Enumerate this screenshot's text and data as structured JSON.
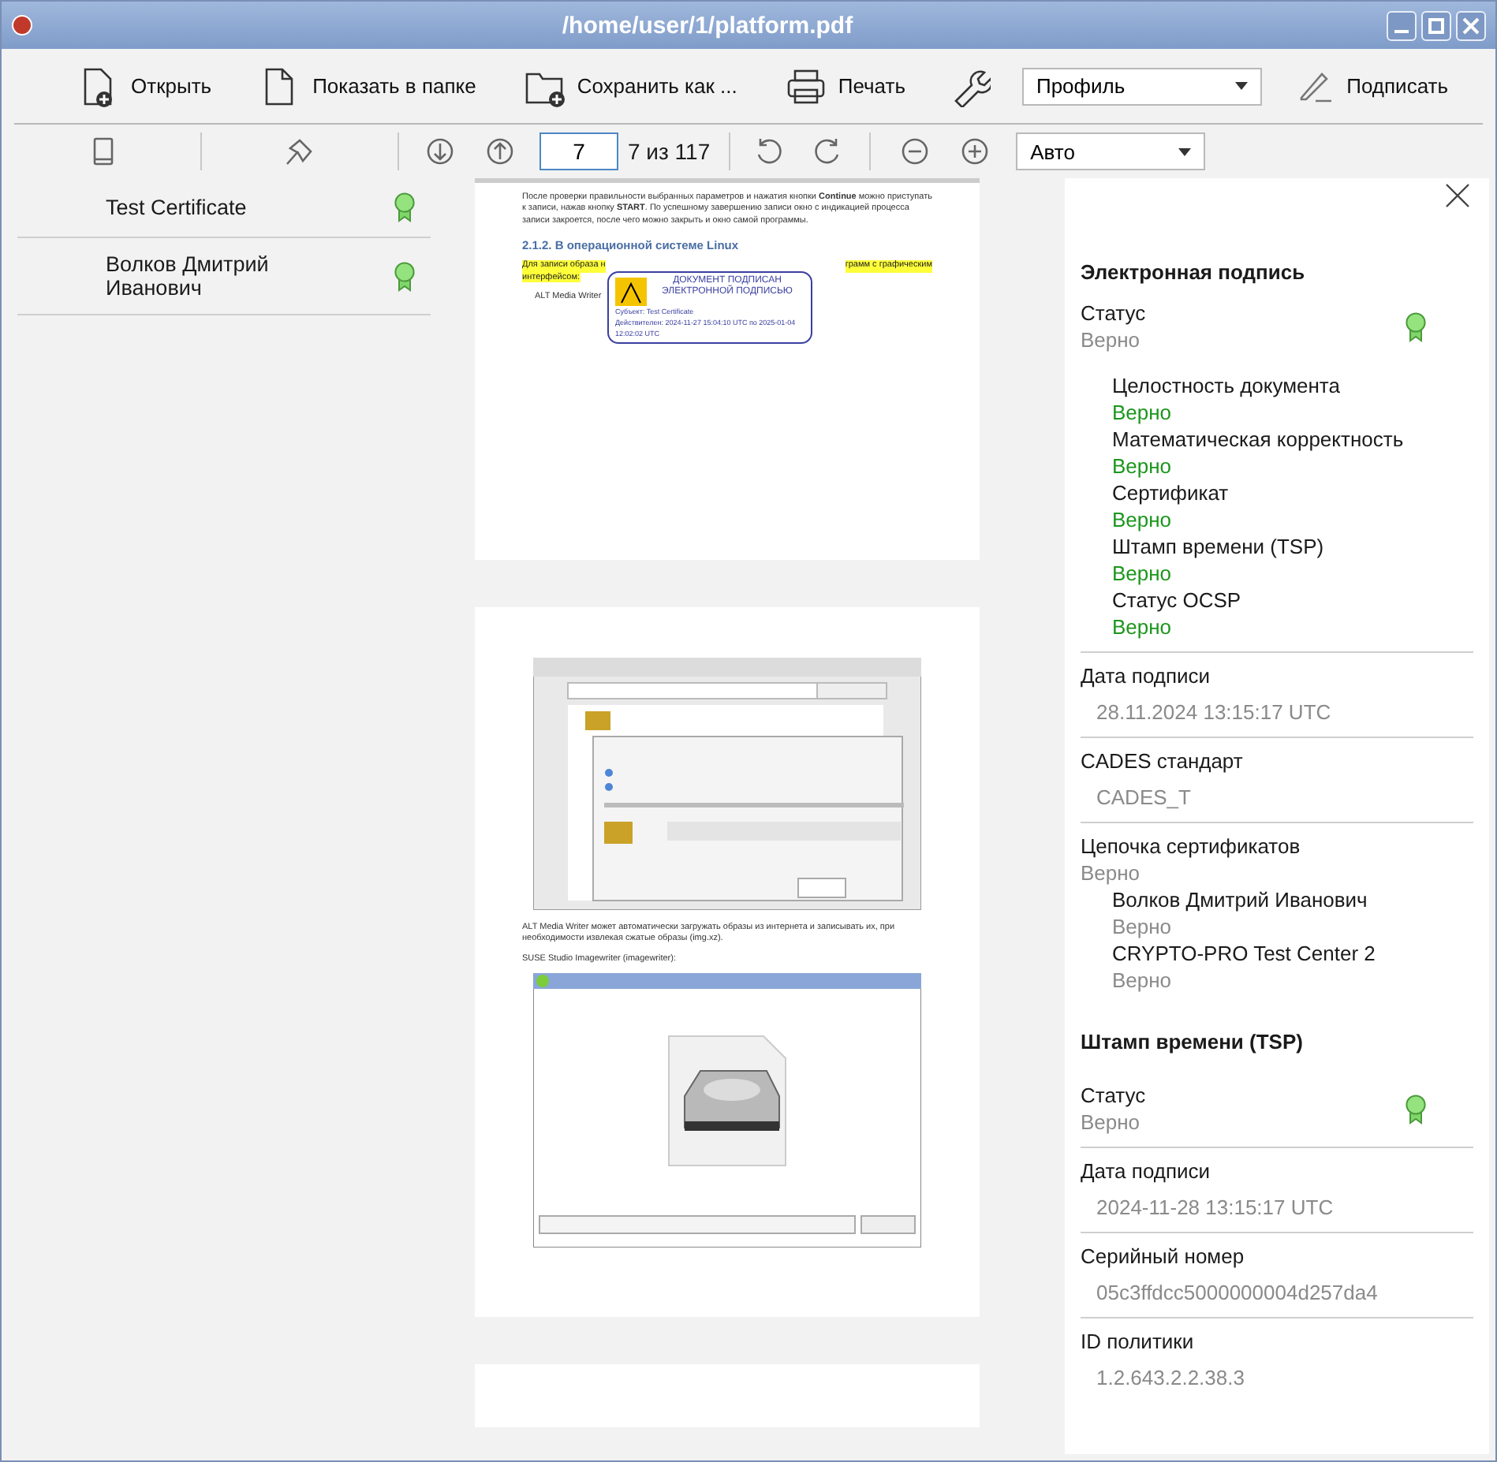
{
  "window": {
    "title": "/home/user/1/platform.pdf"
  },
  "toolbar": {
    "buttons": [
      {
        "label": "Открыть"
      },
      {
        "label": "Показать в папке"
      },
      {
        "label": "Сохранить как ..."
      },
      {
        "label": "Печать"
      }
    ],
    "profile": "Профиль",
    "sign": "Подписать"
  },
  "navbar": {
    "page": "7",
    "page_count": "7 из 117",
    "zoom": "Авто"
  },
  "signatures": [
    {
      "name": "Test Certificate",
      "selected": false
    },
    {
      "name": "Волков Дмитрий Иванович",
      "selected": false
    }
  ],
  "document": {
    "page1": {
      "paragraph": "После проверки правильности выбранных параметров и нажатия кнопки **Continue** можно приступать к записи, нажав кнопку **START**. По успешному завершению записи окно с индикацией процесса записи закроется, после чего можно закрыть и окно самой программы.",
      "heading": "2.1.2. В операционной системе Linux",
      "highlight_left": "Для записи образа н",
      "highlight_right": "грамм с графическим",
      "highlight_line2": "интерфейсом:",
      "bullet": "ALT Media Writer",
      "stamp": {
        "title": "ДОКУМЕНТ ПОДПИСАН ЭЛЕКТРОННОЙ ПОДПИСЬЮ",
        "lines": [
          "Субъект: Test Certificate",
          "Действителен: 2024-11-27 15:04:10 UTC по 2025-01-04 12:02:02 UTC"
        ]
      }
    },
    "page2": {
      "text": "ALT Media Writer может автоматически загружать образы из интернета и записывать их, при необходимости извлекая сжатые образы (img.xz).",
      "bullet": "SUSE Studio Imagewriter (imagewriter):"
    }
  },
  "details": {
    "signature_title": "Электронная подпись",
    "status": {
      "label": "Статус",
      "value": "Верно"
    },
    "checks": [
      {
        "label": "Целостность документа",
        "value": "Верно"
      },
      {
        "label": "Математическая корректность",
        "value": "Верно"
      },
      {
        "label": "Сертификат",
        "value": "Верно"
      },
      {
        "label": "Штамп времени (TSP)",
        "value": "Верно"
      },
      {
        "label": "Статус OCSP",
        "value": "Верно"
      }
    ],
    "date": {
      "label": "Дата подписи",
      "value": "28.11.2024 13:15:17 UTC"
    },
    "cades": {
      "label": "CADES стандарт",
      "value": "CADES_T"
    },
    "chain": {
      "label": "Цепочка сертификатов",
      "value": "Верно",
      "children": [
        {
          "label": "Волков Дмитрий Иванович",
          "value": "Верно"
        },
        {
          "label": "CRYPTO-PRO Test Center 2",
          "value": "Верно"
        }
      ]
    },
    "tsp_title": "Штамп времени (TSP)",
    "tsp_status": {
      "label": "Статус",
      "value": "Верно"
    },
    "tsp_fields": [
      {
        "label": "Дата подписи",
        "value": "2024-11-28 13:15:17 UTC"
      },
      {
        "label": "Серийный номер",
        "value": "05c3ffdcc5000000004d257da4"
      },
      {
        "label": "ID политики",
        "value": "1.2.643.2.2.38.3"
      }
    ]
  }
}
